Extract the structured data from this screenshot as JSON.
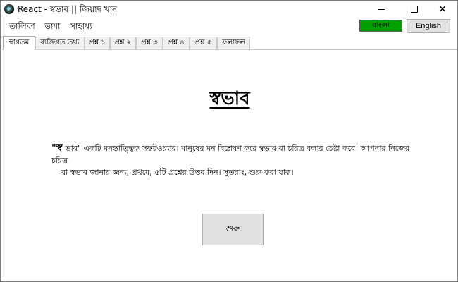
{
  "window": {
    "title": "React - স্বভাব || জিয়াদ খান"
  },
  "menu": {
    "items": [
      "তালিকা",
      "ভাষা",
      "সাহায্য"
    ]
  },
  "language": {
    "bangla_label": "বাংলা",
    "english_label": "English",
    "active_color": "#00a000"
  },
  "tabs": [
    {
      "label": "স্বাগতম",
      "active": true
    },
    {
      "label": "ব্যক্তিগত তথ্য",
      "active": false
    },
    {
      "label": "প্রশ্ন ১",
      "active": false
    },
    {
      "label": "প্রশ্ন ২",
      "active": false
    },
    {
      "label": "প্রশ্ন ৩",
      "active": false
    },
    {
      "label": "প্রশ্ন ৪",
      "active": false
    },
    {
      "label": "প্রশ্ন ৫",
      "active": false
    },
    {
      "label": "ফলাফল",
      "active": false
    }
  ],
  "welcome": {
    "heading": "স্বভাব",
    "quote_open": "\"",
    "brand": "স্ব",
    "line1_rest": " ভাব\" একটি মনস্তাত্ত্বিক সফটওয়্যার। মানুষের মন বিশ্লেষণ করে স্বভাব বা চরিত্র বলার চেষ্টা করে। আপনার নিজের চরিত্র",
    "line2": "বা স্বভাব জানার জন্য, প্রথমে, ৫টি প্রশ্নের উত্তর দিন। সুতরাং, শুরু করা যাক।",
    "start_button": "শুরু"
  }
}
